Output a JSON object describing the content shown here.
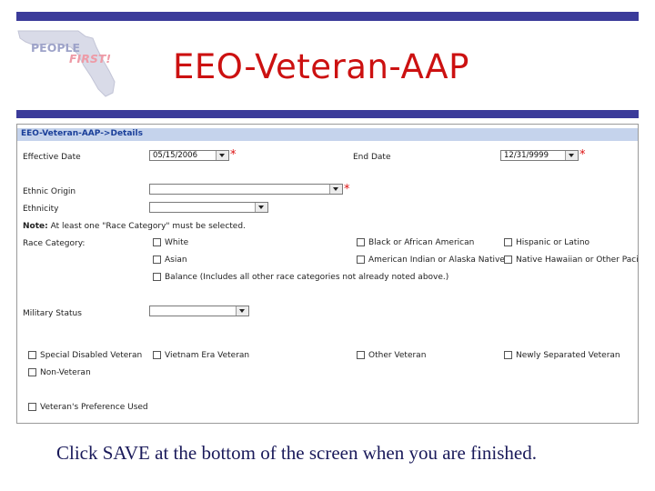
{
  "slide": {
    "title": "EEO-Veteran-AAP",
    "caption": "Click SAVE at the bottom of the screen when you are finished.",
    "logo_line1": "PEOPLE",
    "logo_line2": "FIRST!"
  },
  "screen": {
    "breadcrumb": "EEO-Veteran-AAP->Details",
    "effective_date_label": "Effective Date",
    "effective_date_value": "05/15/2006",
    "end_date_label": "End Date",
    "end_date_value": "12/31/9999",
    "ethnic_origin_label": "Ethnic Origin",
    "ethnicity_label": "Ethnicity",
    "note_bold": "Note:",
    "note_text": "At least one \"Race Category\" must be selected.",
    "race_category_label": "Race Category:",
    "race_options": {
      "white": "White",
      "black": "Black or African American",
      "hispanic": "Hispanic or Latino",
      "asian": "Asian",
      "american_indian": "American Indian or Alaska Native",
      "pacific": "Native Hawaiian or Other Pacific",
      "balance": "Balance (Includes all other race categories not already noted above.)"
    },
    "military_status_label": "Military Status",
    "veteran_options": {
      "special_disabled": "Special Disabled Veteran",
      "vietnam": "Vietnam Era Veteran",
      "other": "Other Veteran",
      "newly_separated": "Newly Separated Veteran",
      "non_veteran": "Non-Veteran",
      "preference": "Veteran's Preference Used"
    },
    "required_mark": "*"
  },
  "colors": {
    "bar": "#3b3b9a",
    "title": "#cc1111",
    "header_bg": "#c5d3ec",
    "header_text": "#1a3f99",
    "required": "#dd1111"
  }
}
